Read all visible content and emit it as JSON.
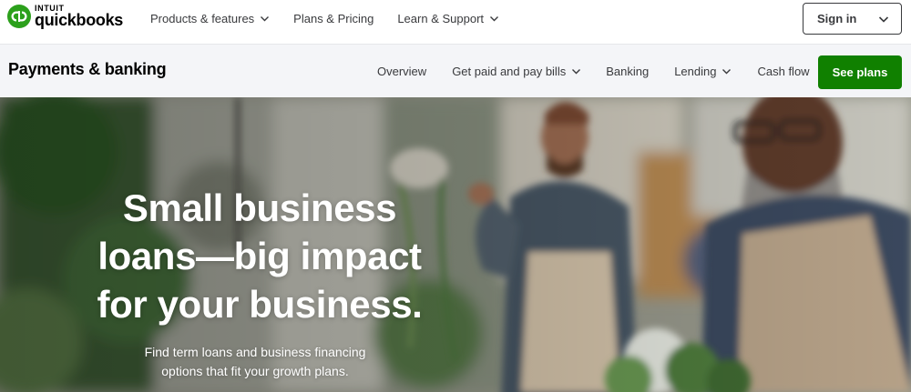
{
  "brand": {
    "intuit": "INTUIT",
    "product": "quickbooks",
    "green": "#2ca01c"
  },
  "topnav": {
    "links": [
      {
        "label": "Products & features",
        "has_dropdown": true
      },
      {
        "label": "Plans & Pricing",
        "has_dropdown": false
      },
      {
        "label": "Learn & Support",
        "has_dropdown": true
      }
    ],
    "signin_label": "Sign in"
  },
  "subnav": {
    "title": "Payments & banking",
    "links": [
      {
        "label": "Overview",
        "has_dropdown": false
      },
      {
        "label": "Get paid and pay bills",
        "has_dropdown": true
      },
      {
        "label": "Banking",
        "has_dropdown": false
      },
      {
        "label": "Lending",
        "has_dropdown": true
      },
      {
        "label": "Cash flow",
        "has_dropdown": false
      }
    ],
    "cta_label": "See plans",
    "cta_color": "#108000"
  },
  "hero": {
    "headline_lines": [
      "Small business",
      "loans—big impact",
      "for your business."
    ],
    "subtext_lines": [
      "Find term loans and business financing",
      "options that fit your growth plans."
    ]
  },
  "icons": {
    "logo": "quickbooks-logo-icon",
    "dropdown": "chevron-down-icon"
  }
}
